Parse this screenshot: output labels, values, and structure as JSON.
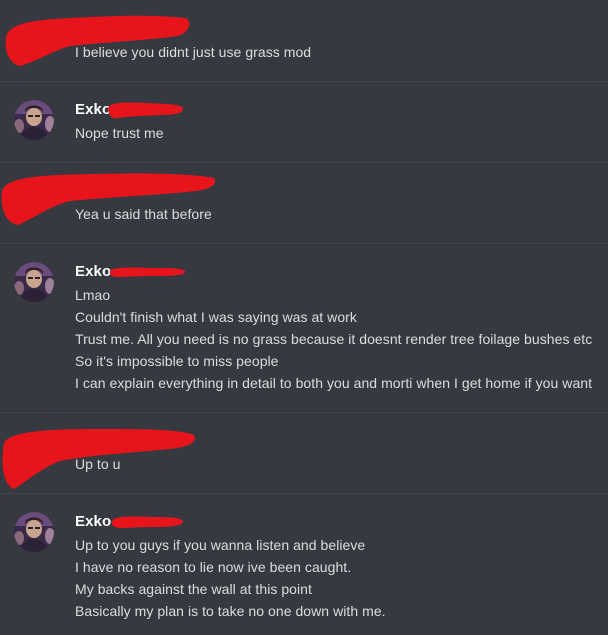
{
  "colors": {
    "background": "#36393f",
    "divider": "#41444b",
    "message_text": "#dcddde",
    "username": "#ffffff",
    "redaction": "#e8141c"
  },
  "messages": [
    {
      "author": "",
      "author_redacted": true,
      "lines": [
        "I believe you didnt just use grass mod"
      ]
    },
    {
      "author": "Exko",
      "avatar_icon": "user-avatar-icon",
      "lines": [
        "Nope trust me"
      ]
    },
    {
      "author": "",
      "author_redacted": true,
      "lines": [
        "Yea u said that before"
      ]
    },
    {
      "author": "Exko",
      "avatar_icon": "user-avatar-icon",
      "lines": [
        "Lmao",
        "Couldn't finish what I was saying was at work",
        "Trust me. All you need is no grass because it doesnt render tree foilage bushes etc",
        "So it's impossible to miss people",
        "I can explain everything in detail to both you and morti when I get home if you want"
      ]
    },
    {
      "author": "",
      "author_redacted": true,
      "lines": [
        "Up to u"
      ]
    },
    {
      "author": "Exko",
      "avatar_icon": "user-avatar-icon",
      "lines": [
        "Up to you guys if you wanna listen and believe",
        "I have no reason to lie now ive been caught.",
        "My backs against the wall at this point",
        "Basically my plan is to take no one down with me."
      ]
    }
  ]
}
